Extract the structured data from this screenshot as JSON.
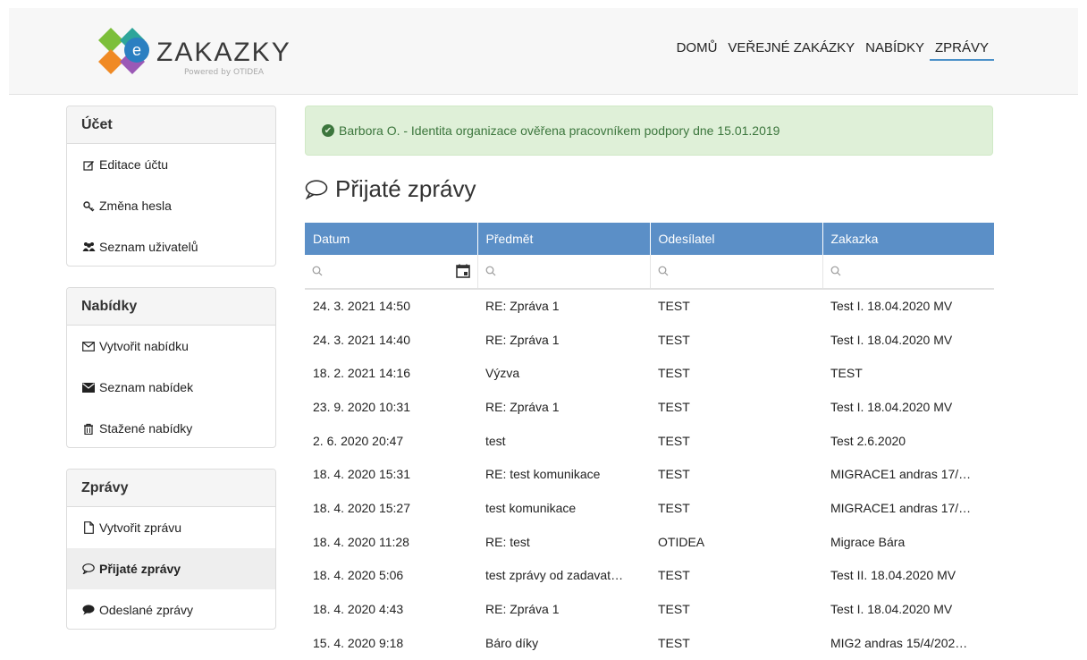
{
  "brand": {
    "name": "ZAKAZKY",
    "tagline": "Powered by OTIDEA",
    "logo_letter": "e"
  },
  "nav": {
    "items": [
      "DOMŮ",
      "VEŘEJNÉ ZAKÁZKY",
      "NABÍDKY",
      "ZPRÁVY"
    ],
    "active": "ZPRÁVY"
  },
  "sidebar": {
    "account": {
      "title": "Účet",
      "items": [
        "Editace účtu",
        "Změna hesla",
        "Seznam uživatelů"
      ]
    },
    "offers": {
      "title": "Nabídky",
      "items": [
        "Vytvořit nabídku",
        "Seznam nabídek",
        "Stažené nabídky"
      ]
    },
    "messages": {
      "title": "Zprávy",
      "items": [
        "Vytvořit zprávu",
        "Přijaté zprávy",
        "Odeslané zprávy"
      ],
      "active": "Přijaté zprávy"
    }
  },
  "alert": {
    "text": "Barbora O. - Identita organizace ověřena pracovníkem podpory dne 15.01.2019"
  },
  "heading": "Přijaté zprávy",
  "table": {
    "columns": [
      "Datum",
      "Předmět",
      "Odesílatel",
      "Zakazka"
    ],
    "rows": [
      [
        "24. 3. 2021 14:50",
        "RE: Zpráva 1",
        "TEST",
        "Test I. 18.04.2020 MV"
      ],
      [
        "24. 3. 2021 14:40",
        "RE: Zpráva 1",
        "TEST",
        "Test I. 18.04.2020 MV"
      ],
      [
        "18. 2. 2021 14:16",
        "Výzva",
        "TEST",
        "TEST"
      ],
      [
        "23. 9. 2020 10:31",
        "RE: Zpráva 1",
        "TEST",
        "Test I. 18.04.2020 MV"
      ],
      [
        "2. 6. 2020 20:47",
        "test",
        "TEST",
        "Test 2.6.2020"
      ],
      [
        "18. 4. 2020 15:31",
        "RE: test komunikace",
        "TEST",
        "MIGRACE1 andras 17/…"
      ],
      [
        "18. 4. 2020 15:27",
        "test komunikace",
        "TEST",
        "MIGRACE1 andras 17/…"
      ],
      [
        "18. 4. 2020 11:28",
        "RE: test",
        "OTIDEA",
        "Migrace Bára"
      ],
      [
        "18. 4. 2020 5:06",
        "test zprávy od zadavat…",
        "TEST",
        "Test II. 18.04.2020 MV"
      ],
      [
        "18. 4. 2020 4:43",
        "RE: Zpráva 1",
        "TEST",
        "Test I. 18.04.2020 MV"
      ],
      [
        "15. 4. 2020 9:18",
        "Báro díky",
        "TEST",
        "MIG2 andras 15/4/202…"
      ]
    ]
  },
  "colors": {
    "header_bg": "#f7f7f7",
    "table_head": "#5b8fc7",
    "alert_bg": "#dff0d8",
    "alert_text": "#3c763d",
    "nav_underline": "#4a90c8"
  },
  "icons": {
    "account": [
      "edit-icon",
      "key-icon",
      "users-icon"
    ],
    "offers": [
      "envelope-outline-icon",
      "envelope-icon",
      "trash-icon"
    ],
    "messages": [
      "file-icon",
      "comment-outline-icon",
      "comment-icon"
    ]
  }
}
